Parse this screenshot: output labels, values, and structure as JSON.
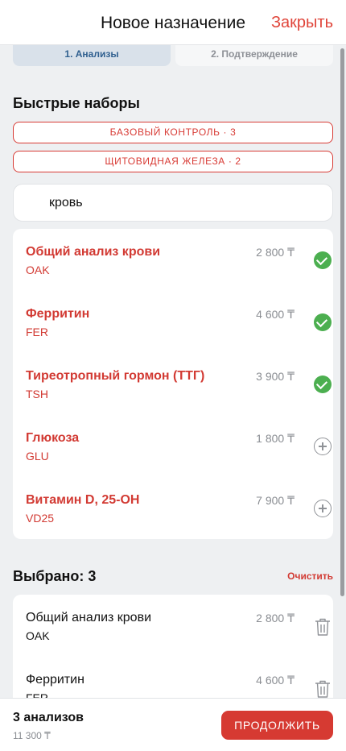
{
  "header": {
    "title": "Новое назначение",
    "close_label": "Закрыть"
  },
  "steps": [
    {
      "label": "1. Анализы"
    },
    {
      "label": "2. Подтверждение"
    }
  ],
  "quick_sets": {
    "title": "Быстрые наборы",
    "items": [
      {
        "label": "Базовый контроль · 3"
      },
      {
        "label": "Щитовидная железа · 2"
      }
    ]
  },
  "search": {
    "value": "кровь"
  },
  "results": [
    {
      "name": "Общий анализ крови",
      "code": "OAK",
      "price": "2 800 ₸",
      "selected": true
    },
    {
      "name": "Ферритин",
      "code": "FER",
      "price": "4 600 ₸",
      "selected": true
    },
    {
      "name": "Тиреотропный гормон (ТТГ)",
      "code": "TSH",
      "price": "3 900 ₸",
      "selected": true
    },
    {
      "name": "Глюкоза",
      "code": "GLU",
      "price": "1 800 ₸",
      "selected": false
    },
    {
      "name": "Витамин D, 25-OH",
      "code": "VD25",
      "price": "7 900 ₸",
      "selected": false
    }
  ],
  "selected": {
    "title": "Выбрано: 3",
    "clear_label": "Очистить",
    "items": [
      {
        "name": "Общий анализ крови",
        "code": "OAK",
        "price": "2 800 ₸"
      },
      {
        "name": "Ферритин",
        "code": "FER",
        "price": "4 600 ₸"
      }
    ]
  },
  "footer": {
    "count": "3 анализов",
    "total": "11 300 ₸",
    "continue_label": "Продолжить"
  },
  "colors": {
    "accent": "#d63a32",
    "success": "#4caf50",
    "step_active_bg": "#d9e1ea"
  }
}
